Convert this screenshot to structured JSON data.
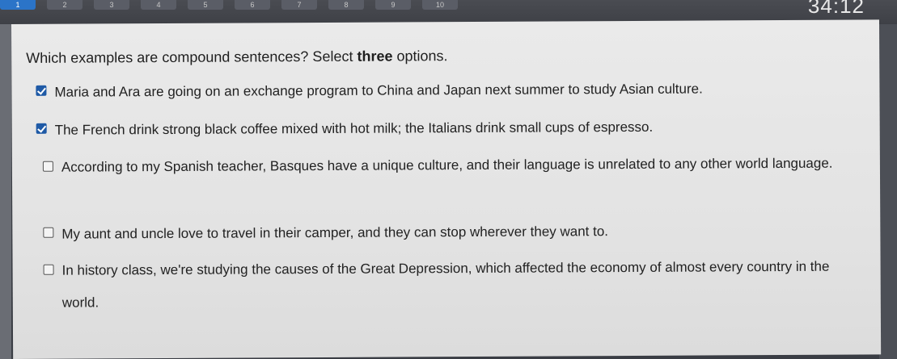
{
  "nav": {
    "items": [
      "1",
      "2",
      "3",
      "4",
      "5",
      "6",
      "7",
      "8",
      "9",
      "10"
    ],
    "current_index": 0
  },
  "timer": "34:12",
  "question": {
    "prefix": "Which examples are compound sentences? Select ",
    "emphasis": "three",
    "suffix": " options."
  },
  "options": [
    {
      "text": "Maria and Ara are going on an exchange program to China and Japan next summer to study Asian culture.",
      "checked": true
    },
    {
      "text": "The French drink strong black coffee mixed with hot milk; the Italians drink small cups of espresso.",
      "checked": true
    },
    {
      "text": "According to my Spanish teacher, Basques have a unique culture, and their language is unrelated to any other world language.",
      "checked": false
    },
    {
      "text": "My aunt and uncle love to travel in their camper, and they can stop wherever they want to.",
      "checked": false
    },
    {
      "text": "In history class, we're studying the causes of the Great Depression, which affected the economy of almost every country in the world.",
      "checked": false
    }
  ],
  "colors": {
    "checkbox_checked": "#1f5aa6",
    "nav_current": "#2b74c8"
  }
}
